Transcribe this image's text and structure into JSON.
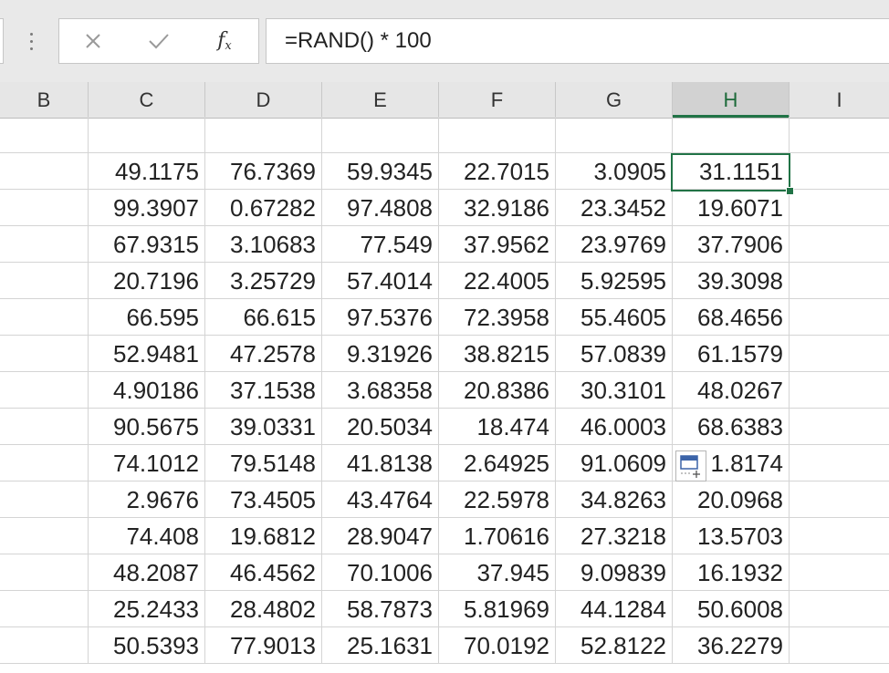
{
  "formula_bar": {
    "cancel_icon": "close-icon",
    "enter_icon": "check-icon",
    "function_label": "f",
    "function_sub": "x",
    "formula": "=RAND() * 100"
  },
  "grid": {
    "columns": [
      "B",
      "C",
      "D",
      "E",
      "F",
      "G",
      "H",
      "I"
    ],
    "active_column": "H",
    "selected_cell": "H2",
    "rows": [
      [
        "",
        "",
        "",
        "",
        "",
        "",
        "",
        ""
      ],
      [
        "",
        "49.1175",
        "76.7369",
        "59.9345",
        "22.7015",
        "3.0905",
        "31.1151",
        ""
      ],
      [
        "",
        "99.3907",
        "0.67282",
        "97.4808",
        "32.9186",
        "23.3452",
        "19.6071",
        ""
      ],
      [
        "",
        "67.9315",
        "3.10683",
        "77.549",
        "37.9562",
        "23.9769",
        "37.7906",
        ""
      ],
      [
        "",
        "20.7196",
        "3.25729",
        "57.4014",
        "22.4005",
        "5.92595",
        "39.3098",
        ""
      ],
      [
        "",
        "66.595",
        "66.615",
        "97.5376",
        "72.3958",
        "55.4605",
        "68.4656",
        ""
      ],
      [
        "",
        "52.9481",
        "47.2578",
        "9.31926",
        "38.8215",
        "57.0839",
        "61.1579",
        ""
      ],
      [
        "",
        "4.90186",
        "37.1538",
        "3.68358",
        "20.8386",
        "30.3101",
        "48.0267",
        ""
      ],
      [
        "",
        "90.5675",
        "39.0331",
        "20.5034",
        "18.474",
        "46.0003",
        "68.6383",
        ""
      ],
      [
        "",
        "74.1012",
        "79.5148",
        "41.8138",
        "2.64925",
        "91.0609",
        "1.8174",
        ""
      ],
      [
        "",
        "2.9676",
        "73.4505",
        "43.4764",
        "22.5978",
        "34.8263",
        "20.0968",
        ""
      ],
      [
        "",
        "74.408",
        "19.6812",
        "28.9047",
        "1.70616",
        "27.3218",
        "13.5703",
        ""
      ],
      [
        "",
        "48.2087",
        "46.4562",
        "70.1006",
        "37.945",
        "9.09839",
        "16.1932",
        ""
      ],
      [
        "",
        "25.2433",
        "28.4802",
        "58.7873",
        "5.81969",
        "44.1284",
        "50.6008",
        ""
      ],
      [
        "",
        "50.5393",
        "77.9013",
        "25.1631",
        "70.0192",
        "52.8122",
        "36.2279",
        ""
      ]
    ]
  },
  "quick_analysis_icon": "quick-analysis-icon",
  "colors": {
    "selection": "#217346",
    "header_bg": "#e6e6e6",
    "active_header_bg": "#d2d2d2",
    "gridline": "#d4d4d4"
  }
}
